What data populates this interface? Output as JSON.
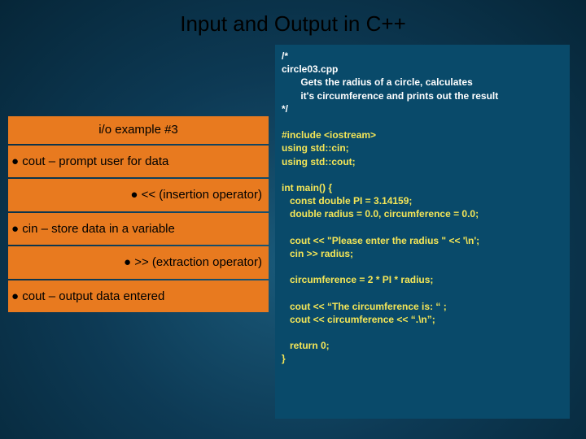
{
  "title": "Input and Output in C++",
  "left": {
    "heading": "i/o example #3",
    "b1": "cout – prompt user for data",
    "b1sub": "<< (insertion operator)",
    "b2": "cin – store data in a variable",
    "b2sub": ">> (extraction operator)",
    "b3": "cout – output data entered"
  },
  "code": {
    "l01": "/*",
    "l02": "circle03.cpp",
    "l03": "       Gets the radius of a circle, calculates",
    "l04": "       it's circumference and prints out the result",
    "l05": "*/",
    "l06": "",
    "l07": "#include <iostream>",
    "l08": "using std::cin;",
    "l09": "using std::cout;",
    "l10": "",
    "l11": "int main() {",
    "l12": "   const double PI = 3.14159;",
    "l13": "   double radius = 0.0, circumference = 0.0;",
    "l14": "",
    "l15": "   cout << \"Please enter the radius \" << '\\n';",
    "l16": "   cin >> radius;",
    "l17": "",
    "l18": "   circumference = 2 * PI * radius;",
    "l19": "",
    "l20": "   cout << “The circumference is: “ ;",
    "l21": "   cout << circumference << “.\\n”;",
    "l22": "",
    "l23": "   return 0;",
    "l24": "}"
  }
}
